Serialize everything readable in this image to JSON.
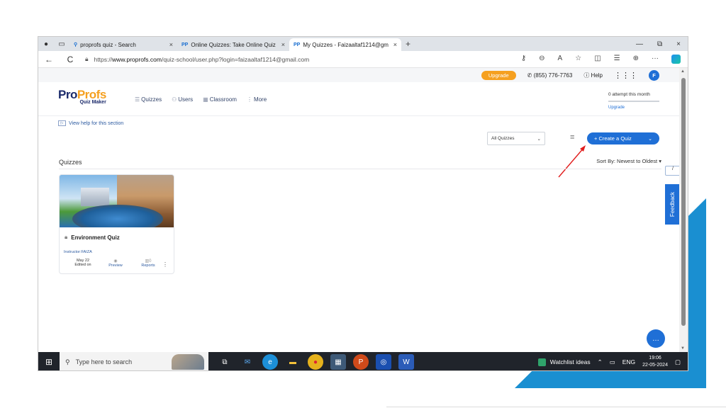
{
  "colors": {
    "accent": "#1f6fd6",
    "upgrade": "#f5a020",
    "deco": "#1a8fd1",
    "taskbar": "#20242b",
    "arrow": "#e11d1d"
  },
  "browser": {
    "tabs": [
      {
        "icon": "search-icon",
        "label": "proprofs quiz - Search"
      },
      {
        "icon": "proprofs-favicon",
        "favicon": "PP",
        "label": "Online Quizzes: Take Online Quiz"
      },
      {
        "icon": "proprofs-favicon",
        "favicon": "PP",
        "label": "My Quizzes - Faizaaltaf1214@gm"
      }
    ],
    "tab_close": "×",
    "new_tab": "+",
    "window_controls": {
      "minimize": "—",
      "restore": "⧉",
      "close": "×"
    },
    "url_prefix": "https://",
    "url_domain": "www.proprofs.com",
    "url_path": "/quiz-school/user.php?login=faizaaltaf1214@gmail.com",
    "nav": {
      "back": "←",
      "refresh": "C"
    }
  },
  "topstrip": {
    "upgrade": "Upgrade",
    "phone": "(855) 776-7763",
    "help": "Help",
    "avatar": "F"
  },
  "logo": {
    "pro": "Pro",
    "profs": "Profs",
    "sub": "Quiz Maker"
  },
  "mainnav": {
    "quizzes": "Quizzes",
    "users": "Users",
    "classroom": "Classroom",
    "more": "More"
  },
  "attempts": {
    "text": "0 attempt this month",
    "upgrade": "Upgrade"
  },
  "help_link": "View help for this section",
  "filter": {
    "selected": "All Quizzes"
  },
  "create_button": "+ Create a Quiz",
  "section": {
    "title": "Quizzes",
    "sort_label": "Sort By:",
    "sort_value": "Newest to Oldest"
  },
  "side_input_value": "/",
  "feedback": "Feedback",
  "quiz_card": {
    "name": "Environment Quiz",
    "instructor_label": "Instructor:",
    "instructor": "FAIZA",
    "edited_date": "May 22",
    "edited_label": "Edited on",
    "preview_label": "Preview",
    "reports_count": "0",
    "reports_label": "Reports"
  },
  "taskbar": {
    "search_placeholder": "Type here to search",
    "watchlist": "Watchlist ideas",
    "lang": "ENG",
    "time": "19:06",
    "date": "22-05-2024"
  }
}
